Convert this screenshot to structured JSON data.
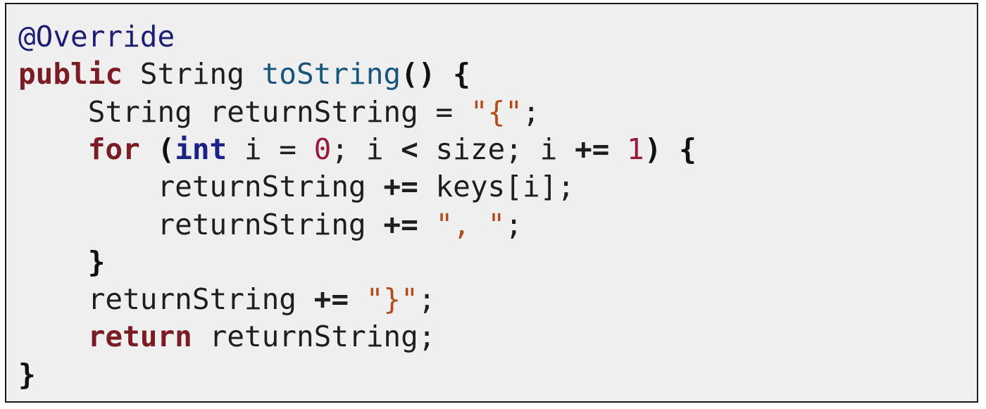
{
  "code_block": {
    "language": "java",
    "colors": {
      "background": "#efefef",
      "border": "#1a1a1a",
      "annotation": "#1b1e73",
      "keyword": "#7a1c24",
      "type": "#1b2485",
      "method": "#17557a",
      "string": "#b24d1a",
      "number": "#9a1a3b",
      "plain": "#1e1e1e"
    },
    "lines": [
      {
        "indent": 0,
        "tokens": [
          {
            "text": "@Override",
            "kind": "annotation"
          }
        ]
      },
      {
        "indent": 0,
        "tokens": [
          {
            "text": "public",
            "kind": "keyword"
          },
          {
            "text": " String ",
            "kind": "plain"
          },
          {
            "text": "toString",
            "kind": "method"
          },
          {
            "text": "() {",
            "kind": "bracket"
          }
        ]
      },
      {
        "indent": 1,
        "tokens": [
          {
            "text": "String returnString = ",
            "kind": "plain"
          },
          {
            "text": "\"{\"",
            "kind": "string"
          },
          {
            "text": ";",
            "kind": "plain"
          }
        ]
      },
      {
        "indent": 1,
        "tokens": [
          {
            "text": "for",
            "kind": "keyword"
          },
          {
            "text": " (",
            "kind": "bracket"
          },
          {
            "text": "int",
            "kind": "type"
          },
          {
            "text": " i = ",
            "kind": "plain"
          },
          {
            "text": "0",
            "kind": "number"
          },
          {
            "text": "; i ",
            "kind": "plain"
          },
          {
            "text": "<",
            "kind": "operator"
          },
          {
            "text": " size; i ",
            "kind": "plain"
          },
          {
            "text": "+=",
            "kind": "operator"
          },
          {
            "text": " ",
            "kind": "plain"
          },
          {
            "text": "1",
            "kind": "number"
          },
          {
            "text": ") {",
            "kind": "bracket"
          }
        ]
      },
      {
        "indent": 2,
        "tokens": [
          {
            "text": "returnString ",
            "kind": "plain"
          },
          {
            "text": "+=",
            "kind": "operator"
          },
          {
            "text": " keys[i];",
            "kind": "plain"
          }
        ]
      },
      {
        "indent": 2,
        "tokens": [
          {
            "text": "returnString ",
            "kind": "plain"
          },
          {
            "text": "+=",
            "kind": "operator"
          },
          {
            "text": " ",
            "kind": "plain"
          },
          {
            "text": "\", \"",
            "kind": "string"
          },
          {
            "text": ";",
            "kind": "plain"
          }
        ]
      },
      {
        "indent": 1,
        "tokens": [
          {
            "text": "}",
            "kind": "bracket"
          }
        ]
      },
      {
        "indent": 1,
        "tokens": [
          {
            "text": "returnString ",
            "kind": "plain"
          },
          {
            "text": "+=",
            "kind": "operator"
          },
          {
            "text": " ",
            "kind": "plain"
          },
          {
            "text": "\"}\"",
            "kind": "string"
          },
          {
            "text": ";",
            "kind": "plain"
          }
        ]
      },
      {
        "indent": 1,
        "tokens": [
          {
            "text": "return",
            "kind": "keyword"
          },
          {
            "text": " returnString;",
            "kind": "plain"
          }
        ]
      },
      {
        "indent": 0,
        "tokens": [
          {
            "text": "}",
            "kind": "bracket"
          }
        ]
      }
    ]
  }
}
